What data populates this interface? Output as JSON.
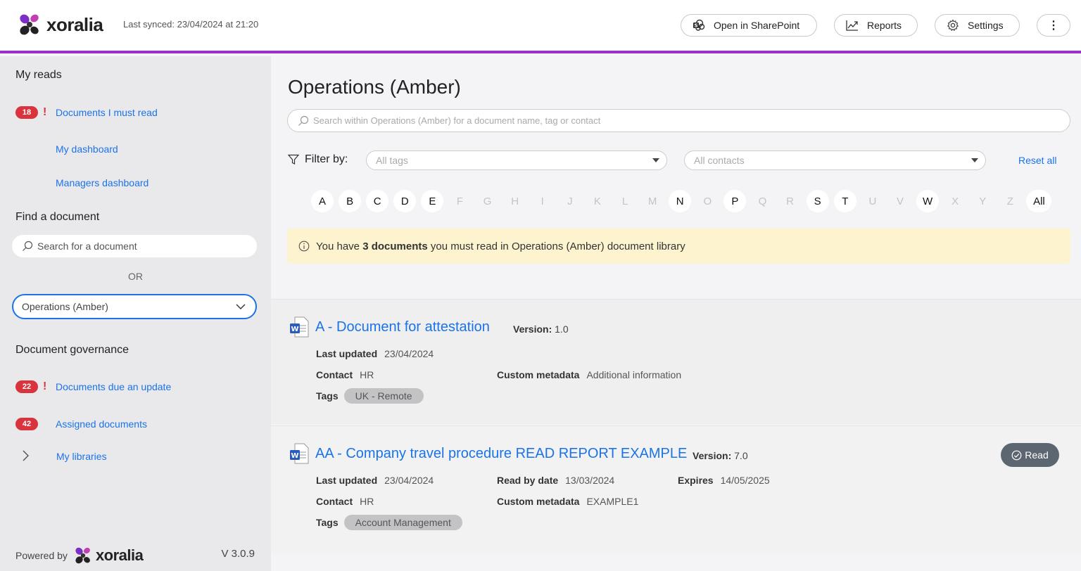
{
  "header": {
    "logo_text": "xoralia",
    "last_synced": "Last synced: 23/04/2024 at 21:20",
    "buttons": {
      "sharepoint": "Open in SharePoint",
      "reports": "Reports",
      "settings": "Settings",
      "more": "⋮"
    }
  },
  "sidebar": {
    "my_reads_heading": "My reads",
    "must_read": {
      "badge": "18",
      "label": "Documents I must read"
    },
    "my_dashboard": "My dashboard",
    "managers_dashboard": "Managers dashboard",
    "find_heading": "Find a document",
    "search_placeholder": "Search for a document",
    "or_label": "OR",
    "library_select": "Operations (Amber)",
    "governance_heading": "Document governance",
    "due_update": {
      "badge": "22",
      "label": "Documents due an update"
    },
    "assigned": {
      "badge": "42",
      "label": "Assigned documents"
    },
    "my_libraries": "My libraries",
    "footer": {
      "powered_by": "Powered by",
      "logo_text": "xoralia",
      "version": "V 3.0.9"
    }
  },
  "main": {
    "title": "Operations (Amber)",
    "search_placeholder": "Search within Operations (Amber) for a document name, tag or contact",
    "filter_label": "Filter by:",
    "tags_placeholder": "All tags",
    "contacts_placeholder": "All contacts",
    "reset_all": "Reset all",
    "alphabet": [
      {
        "l": "A",
        "on": true
      },
      {
        "l": "B",
        "on": true
      },
      {
        "l": "C",
        "on": true
      },
      {
        "l": "D",
        "on": true
      },
      {
        "l": "E",
        "on": true
      },
      {
        "l": "F",
        "on": false
      },
      {
        "l": "G",
        "on": false
      },
      {
        "l": "H",
        "on": false
      },
      {
        "l": "I",
        "on": false
      },
      {
        "l": "J",
        "on": false
      },
      {
        "l": "K",
        "on": false
      },
      {
        "l": "L",
        "on": false
      },
      {
        "l": "M",
        "on": false
      },
      {
        "l": "N",
        "on": true
      },
      {
        "l": "O",
        "on": false
      },
      {
        "l": "P",
        "on": true
      },
      {
        "l": "Q",
        "on": false
      },
      {
        "l": "R",
        "on": false
      },
      {
        "l": "S",
        "on": true
      },
      {
        "l": "T",
        "on": true
      },
      {
        "l": "U",
        "on": false
      },
      {
        "l": "V",
        "on": false
      },
      {
        "l": "W",
        "on": true
      },
      {
        "l": "X",
        "on": false
      },
      {
        "l": "Y",
        "on": false
      },
      {
        "l": "Z",
        "on": false
      },
      {
        "l": "All",
        "on": true
      }
    ],
    "notice": {
      "prefix": "You have ",
      "bold": "3 documents",
      "suffix": " you must read in Operations (Amber) document library"
    },
    "documents": [
      {
        "title": "A - Document for attestation",
        "version_label": "Version:",
        "version": "1.0",
        "last_updated_label": "Last updated",
        "last_updated": "23/04/2024",
        "contact_label": "Contact",
        "contact": "HR",
        "custom_label": "Custom metadata",
        "custom": "Additional information",
        "tags_label": "Tags",
        "tag": "UK - Remote"
      },
      {
        "title": "AA - Company travel procedure READ REPORT EXAMPLE",
        "version_label": "Version:",
        "version": "7.0",
        "last_updated_label": "Last updated",
        "last_updated": "23/04/2024",
        "read_by_label": "Read by date",
        "read_by": "13/03/2024",
        "expires_label": "Expires",
        "expires": "14/05/2025",
        "contact_label": "Contact",
        "contact": "HR",
        "custom_label": "Custom metadata",
        "custom": "EXAMPLE1",
        "tags_label": "Tags",
        "tag": "Account Management",
        "read_button": "Read"
      }
    ]
  },
  "colors": {
    "accent_purple": "#9b2fc7",
    "link_blue": "#1a73e8",
    "badge_red": "#d9343d",
    "notice_yellow": "#fdf3cf"
  }
}
